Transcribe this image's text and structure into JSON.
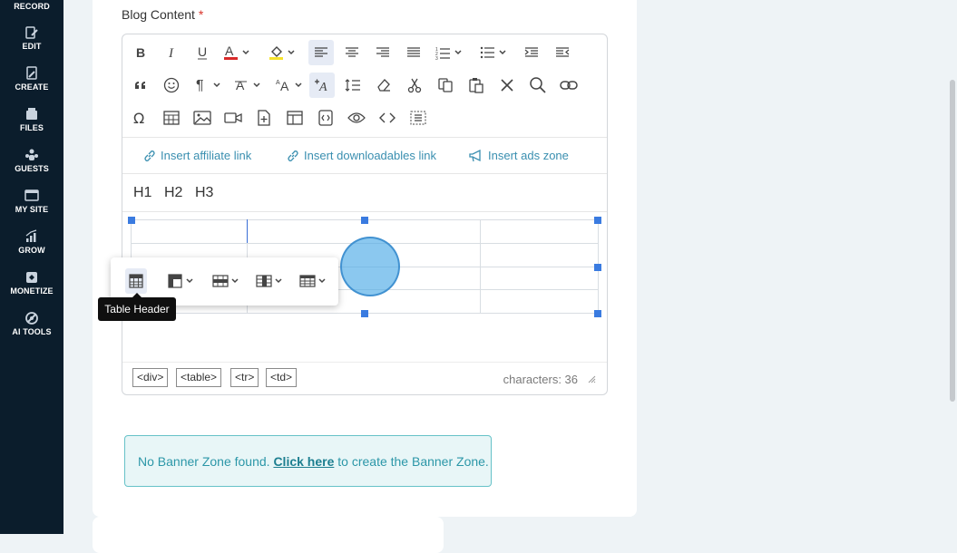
{
  "sidebar": {
    "items": [
      {
        "label": "RECORD",
        "icon": "record-icon"
      },
      {
        "label": "EDIT",
        "icon": "edit-icon"
      },
      {
        "label": "CREATE",
        "icon": "create-icon"
      },
      {
        "label": "FILES",
        "icon": "files-icon"
      },
      {
        "label": "GUESTS",
        "icon": "guests-icon"
      },
      {
        "label": "MY SITE",
        "icon": "my-site-icon"
      },
      {
        "label": "GROW",
        "icon": "grow-icon"
      },
      {
        "label": "MONETIZE",
        "icon": "monetize-icon"
      },
      {
        "label": "AI TOOLS",
        "icon": "ai-tools-icon"
      }
    ]
  },
  "field": {
    "label": "Blog Content",
    "required_mark": "*"
  },
  "editor": {
    "insert_links": {
      "affiliate": "Insert affiliate link",
      "downloadables": "Insert downloadables link",
      "ads": "Insert ads zone"
    },
    "headings": {
      "h1": "H1",
      "h2": "H2",
      "h3": "H3"
    },
    "path_tags": [
      "<div>",
      "<table>",
      "<tr>",
      "<td>"
    ],
    "char_count": "characters: 36",
    "tooltip": "Table Header"
  },
  "banner": {
    "prefix": "No Banner Zone found. ",
    "link": "Click here",
    "suffix": " to create the Banner Zone."
  },
  "colors": {
    "sidebar_bg": "#0b1d2c",
    "accent_link": "#3a8fb0",
    "selection": "#3a7be0",
    "required": "#d9342b"
  }
}
